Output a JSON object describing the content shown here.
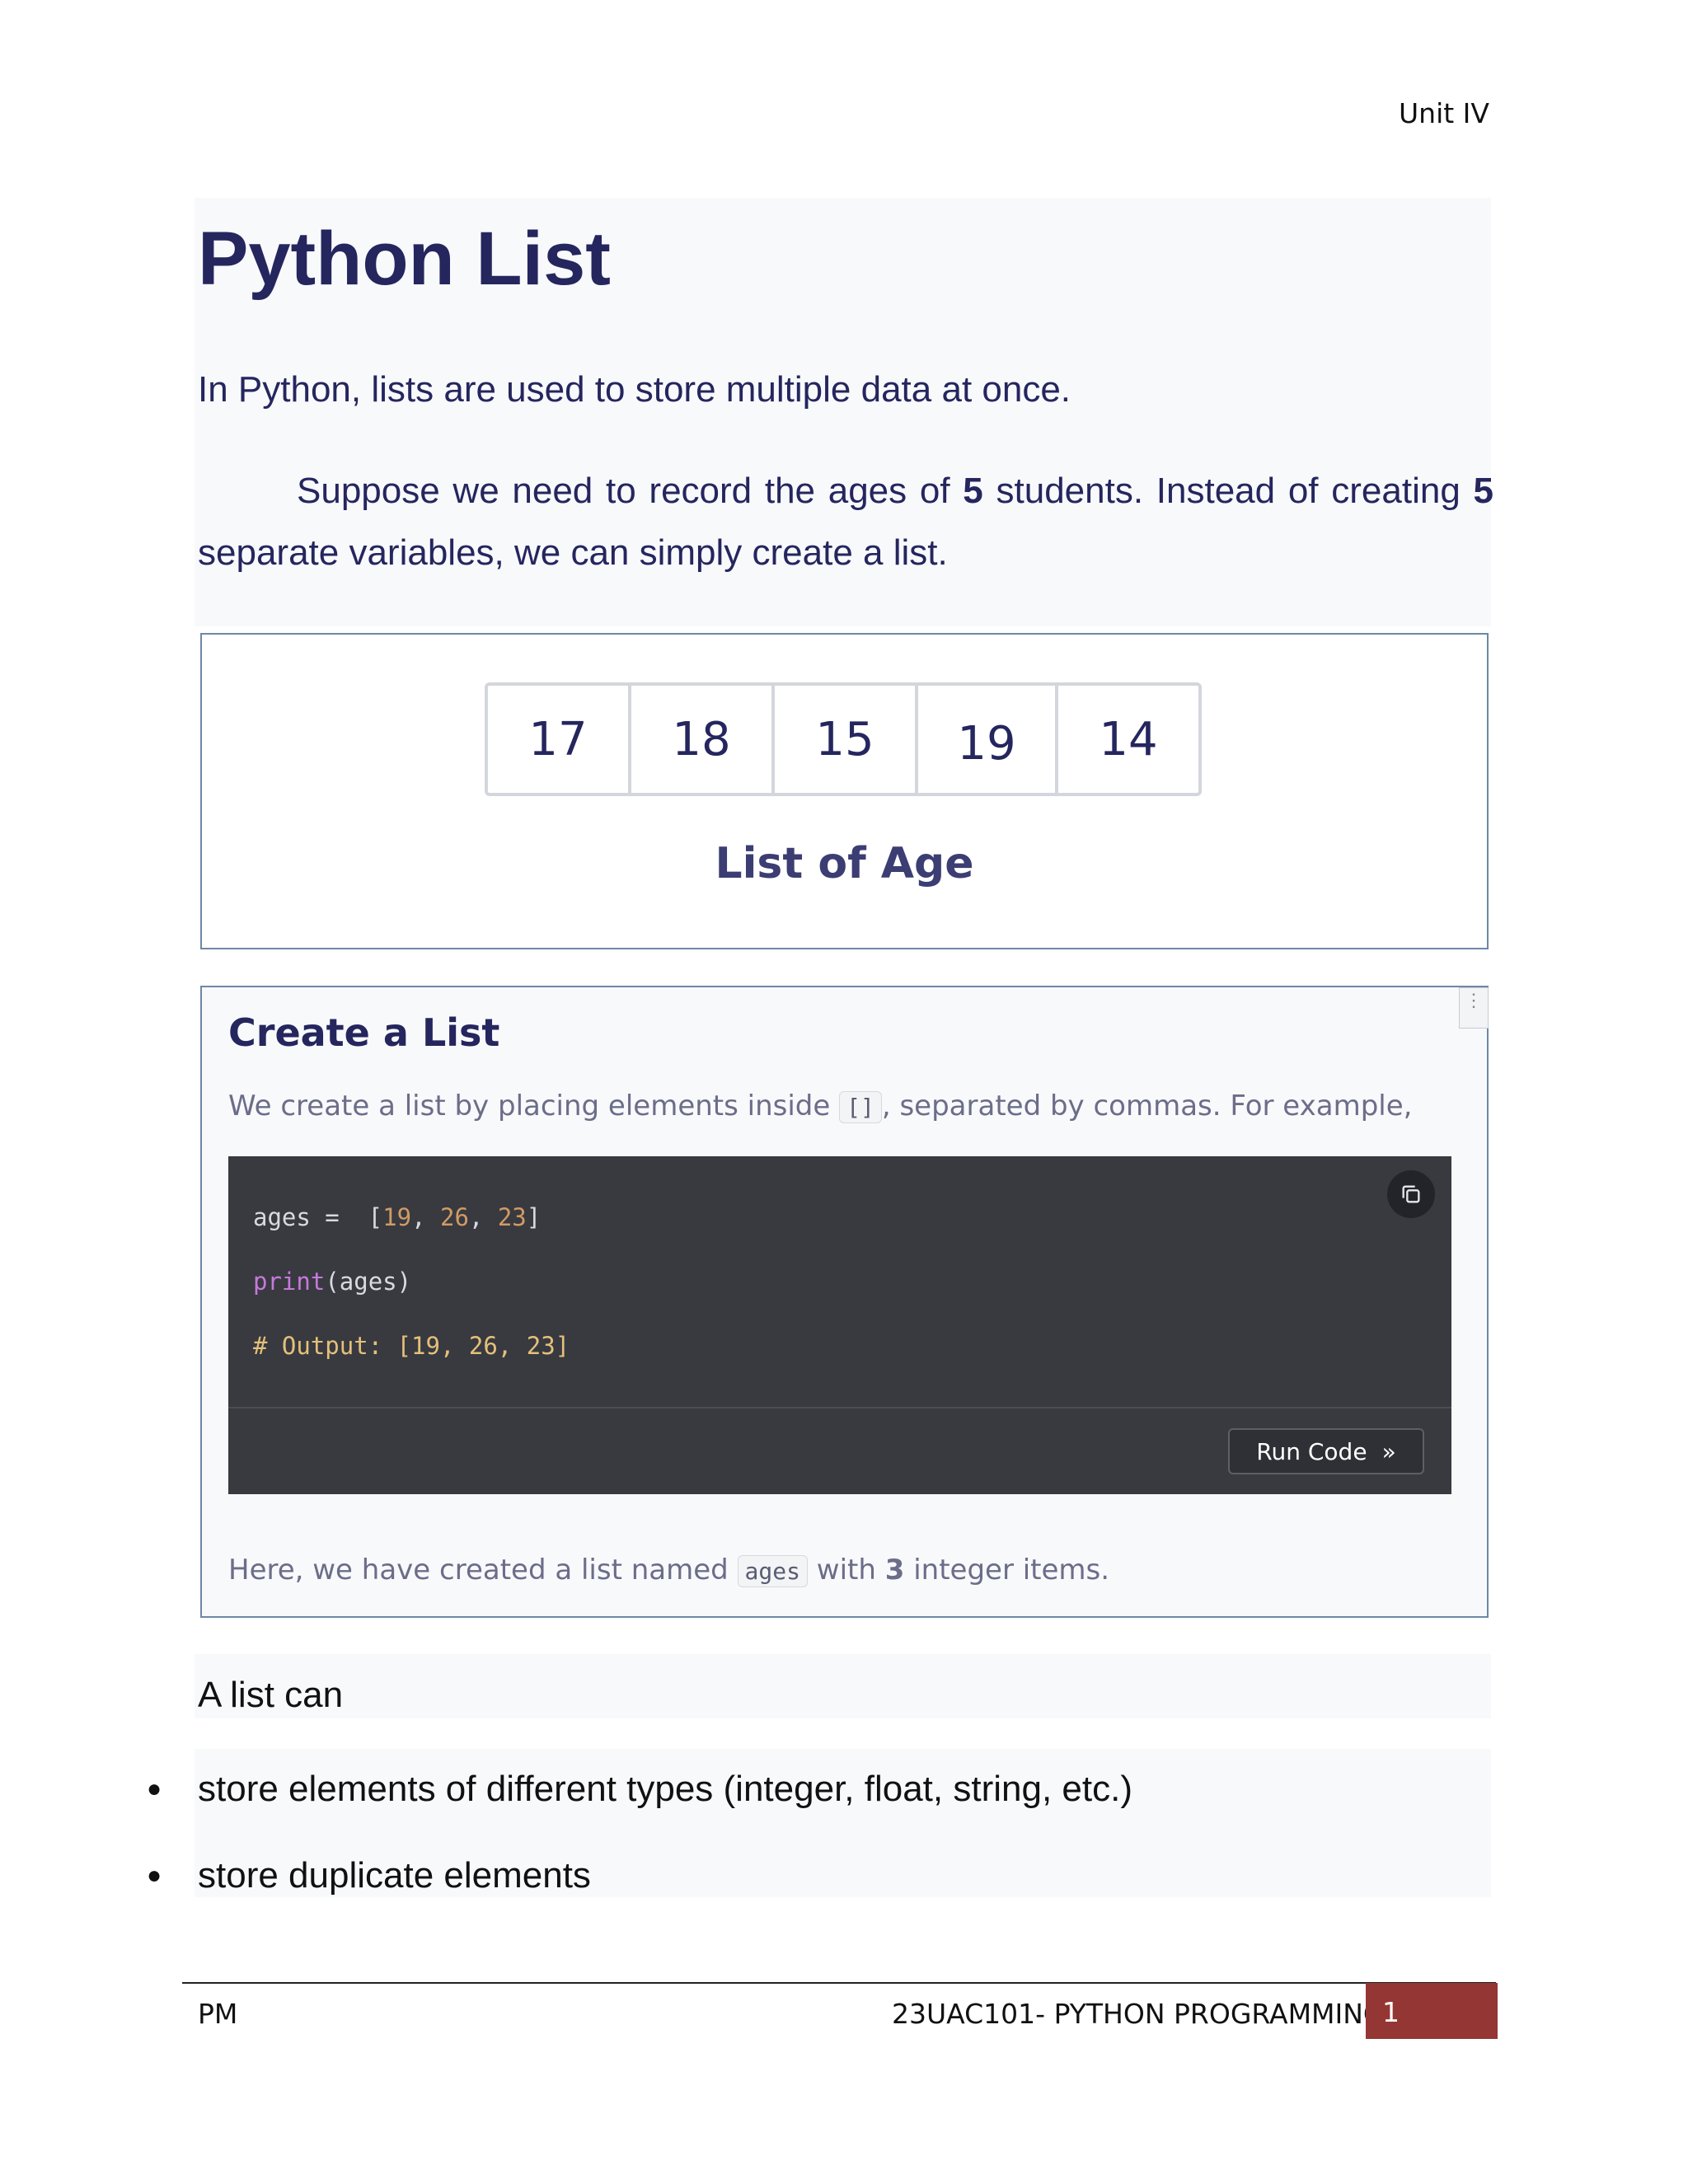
{
  "header": {
    "unit": "Unit IV"
  },
  "section": {
    "title": "Python List",
    "intro": "In Python, lists are used to store multiple data at once.",
    "para": {
      "part1": "Suppose we need to record the ages of ",
      "num1": "5",
      "part2": " students. Instead of creating ",
      "num2": "5",
      "part3": " separate variables, we can simply create a list."
    }
  },
  "figure": {
    "cells": [
      "17",
      "18",
      "15",
      "19",
      "14"
    ],
    "caption": "List of Age"
  },
  "create_list": {
    "title": "Create a List",
    "desc_before": "We create a list by placing elements inside ",
    "desc_code": "[]",
    "desc_after": ", separated by commas. For example,",
    "code": {
      "line1_prefix": "ages = ",
      "line1_open": " [",
      "n1": "19",
      "n2": "26",
      "n3": "23",
      "line1_close": "]",
      "line2_fn": "print",
      "line2_rest": "(ages)",
      "line3": "# Output: [19, 26, 23]"
    },
    "run_label": "Run Code",
    "run_icon": "»",
    "foot_before": "Here, we have created a list named ",
    "foot_code": "ages",
    "foot_mid": " with ",
    "foot_num": "3",
    "foot_after": " integer items."
  },
  "list_can": {
    "lead": "A list can",
    "bullets": [
      "store elements of different types (integer, float, string, etc.)",
      "store duplicate elements"
    ]
  },
  "footer": {
    "left": "PM",
    "center": "23UAC101- PYTHON PROGRAMMING",
    "page": "1",
    "accent": "#943634"
  }
}
